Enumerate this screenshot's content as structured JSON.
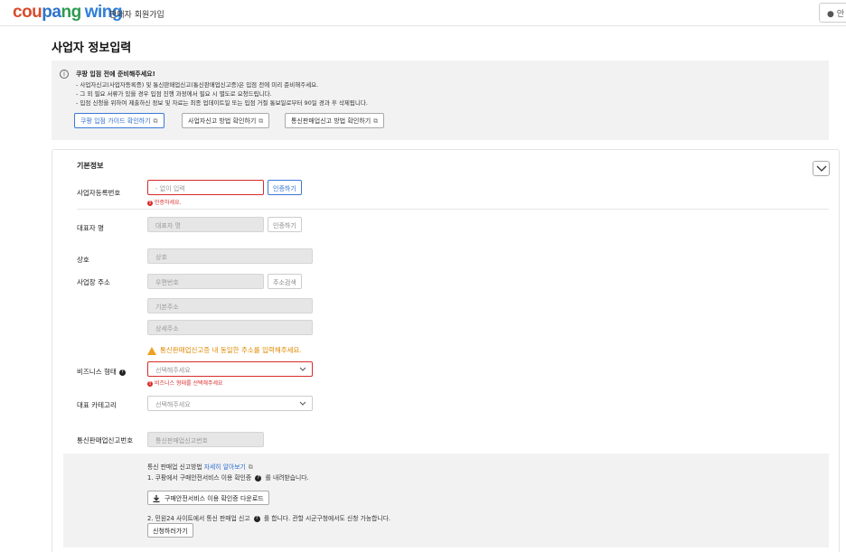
{
  "header": {
    "logo_part1": "cou",
    "logo_part2": "pa",
    "logo_part3": "ng",
    "logo_part4": "wing",
    "subtitle": "판매자 회원가입",
    "right_button": "● 안"
  },
  "page_title": "사업자 정보입력",
  "notice": {
    "icon": "info-icon",
    "title": "쿠팡 입점 전에 준비해주세요!",
    "lines": [
      "- 사업자신고(사업자등록증) 및 통신판매업신고(통신판매업신고증)은 입점 전에 미리 준비해주세요.",
      "- 그 외 필요 서류가 있을 경우 입점 진행 과정에서 필요 시 별도로 요청드립니다.",
      "- 입점 신청을 위하여 제출하신 정보 및 자료는 최종 업데이트일 또는 입점 거절 통보일로부터 90일 경과 후 삭제됩니다."
    ],
    "buttons": [
      "쿠팡 입점 가이드 확인하기",
      "사업자신고 방법 확인하기",
      "통신판매업신고 방법 확인하기"
    ],
    "ext_icon": "⧉"
  },
  "form": {
    "section_title": "기본정보",
    "business_number": {
      "label": "사업자등록번호",
      "placeholder": "- 없이 입력",
      "button": "인증하기",
      "error": "인증하세요."
    },
    "representative": {
      "label": "대표자 명",
      "placeholder": "대표자 명",
      "button": "인증하기"
    },
    "company_name": {
      "label": "상호",
      "placeholder": "상호"
    },
    "address": {
      "label": "사업장 주소",
      "zip_placeholder": "우편번호",
      "search_button": "주소검색",
      "base_placeholder": "기본주소",
      "detail_placeholder": "상세주소",
      "warning": "통신판매업신고증 내 동일한 주소를 입력해주세요."
    },
    "business_type": {
      "label": "비즈니스 형태",
      "help": "?",
      "placeholder": "선택해주세요",
      "error": "비즈니스 형태를 선택해주세요"
    },
    "category": {
      "label": "대표 카테고리",
      "placeholder": "선택해주세요"
    },
    "ecommerce_number": {
      "label": "통신판매업신고번호",
      "placeholder": "통신판매업신고번호"
    }
  },
  "info_box": {
    "heading": "통신 판매업 신고방법",
    "heading_link": "자세히 알아보기",
    "step1": "1. 쿠팡에서 구매안전서비스 이용 확인증",
    "step1_tail": "를 내려받습니다.",
    "download_button": "구매안전서비스 이용 확인증 다운로드",
    "step2": "2. 민원24 사이트에서 통신 판매업 신고",
    "step2_tail": "를 합니다. 관할 시군구청에서도 신청 가능합니다.",
    "apply_button": "신청하러가기"
  },
  "colors": {
    "primary": "#2f6fd2",
    "error": "#d92b2b",
    "warning": "#e08a00",
    "logo_red": "#d64d2e",
    "logo_green": "#2d9b4f",
    "logo_blue": "#2f7fd8"
  }
}
